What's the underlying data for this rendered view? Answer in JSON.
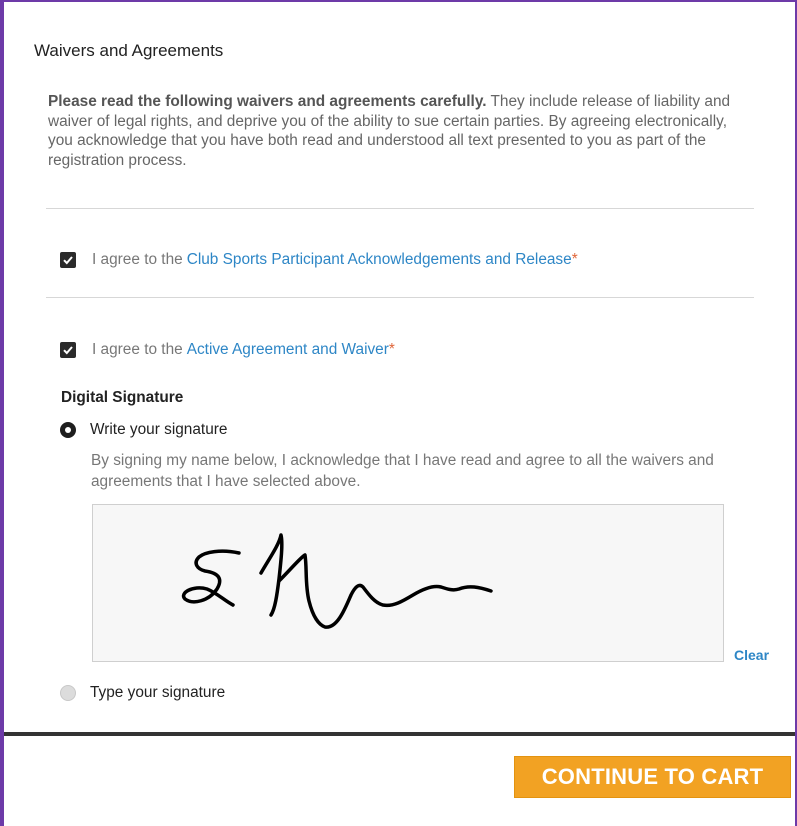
{
  "section": {
    "title": "Waivers and Agreements"
  },
  "intro": {
    "bold": "Please read the following waivers and agreements carefully.",
    "text": " They include release of liability and waiver of legal rights, and deprive you of the ability to sue certain parties. By agreeing electronically, you acknowledge that you have both read and understood all text presented to you as part of the registration process."
  },
  "agreements": [
    {
      "prefix": "I agree to the",
      "link": "Club Sports Participant Acknowledgements and Release",
      "required": "*",
      "checked": true
    },
    {
      "prefix": "I agree to the",
      "link": "Active Agreement and Waiver",
      "required": "*",
      "checked": true
    }
  ],
  "signature": {
    "heading": "Digital Signature",
    "write_option": "Write your signature",
    "type_option": "Type your signature",
    "selected": "write",
    "note": "By signing my name below, I acknowledge that I have read and agree to all the waivers and agreements that I have selected above.",
    "clear_label": "Clear"
  },
  "footer": {
    "continue_label": "CONTINUE TO CART"
  },
  "colors": {
    "accent": "#f2a223",
    "link": "#2d86c6",
    "required": "#e0663a",
    "frame": "#6d3aa8"
  },
  "icons": {
    "checkbox": "checkmark-icon",
    "radio": "radio-icon"
  }
}
